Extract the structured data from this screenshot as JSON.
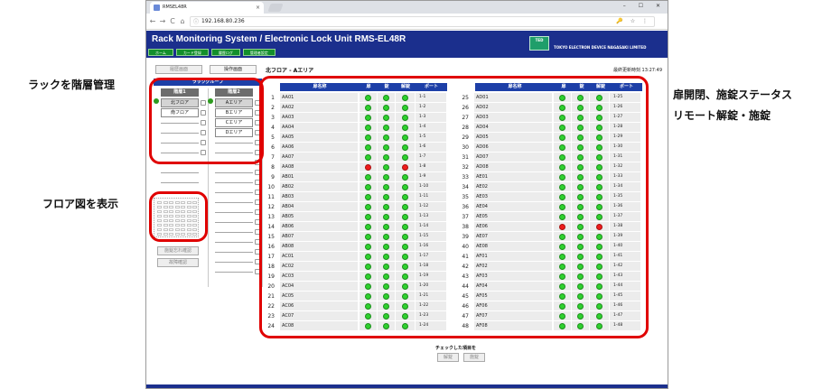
{
  "browser": {
    "tab_title": "RMSEL48R",
    "tab_close": "×",
    "url": "192.168.80.236",
    "url_info_icon": "ⓘ",
    "toolbar_icons": "🔑 ☆ ⋮",
    "window_controls": "– ☐ ✕",
    "nav": {
      "back": "←",
      "forward": "→",
      "reload": "C",
      "home": "⌂"
    }
  },
  "app": {
    "title": "Rack Monitoring System / Electronic Lock Unit RMS-EL48R",
    "menu": [
      "ホーム",
      "カード登録",
      "履歴ログ",
      "管理者設定"
    ],
    "logo_text": "TED",
    "company": "TOKYO ELECTRON DEVICE NAGASAKI LIMITED",
    "colors": {
      "header": "#1b2f8d",
      "menu": "#138f2c",
      "table_header": "#1d3fa7",
      "led_green": "#2fd02f",
      "led_red": "#ee1c1c"
    }
  },
  "buttons": {
    "history_view": "履歴画面",
    "operation_view": "操作画面",
    "floor_check": "施錠忘れ確認",
    "fault_check": "故障確認",
    "unlock": "解錠",
    "lock": "施錠"
  },
  "area_title": "北フロア - Aエリア",
  "updated": "最終更新時刻 13:27:49",
  "group": {
    "heading": "ラックグループ",
    "level1_label": "階層1",
    "level2_label": "階層2",
    "level1_items": [
      "北フロア",
      "南フロア"
    ],
    "level2_items": [
      "Aエリア",
      "Bエリア",
      "Cエリア",
      "Dエリア"
    ]
  },
  "table": {
    "headers": {
      "name": "扉名称",
      "door": "扉",
      "lock": "錠",
      "unlock": "解錠",
      "port": "ポート"
    },
    "rows": [
      {
        "num": "1",
        "name": "AA01",
        "port": "1-1",
        "door": "green",
        "lock": "green",
        "unlock": "green"
      },
      {
        "num": "2",
        "name": "AA02",
        "port": "1-2",
        "door": "green",
        "lock": "green",
        "unlock": "green"
      },
      {
        "num": "3",
        "name": "AA03",
        "port": "1-3",
        "door": "green",
        "lock": "green",
        "unlock": "green"
      },
      {
        "num": "4",
        "name": "AA04",
        "port": "1-4",
        "door": "green",
        "lock": "green",
        "unlock": "green"
      },
      {
        "num": "5",
        "name": "AA05",
        "port": "1-5",
        "door": "green",
        "lock": "green",
        "unlock": "green"
      },
      {
        "num": "6",
        "name": "AA06",
        "port": "1-6",
        "door": "green",
        "lock": "green",
        "unlock": "green"
      },
      {
        "num": "7",
        "name": "AA07",
        "port": "1-7",
        "door": "green",
        "lock": "green",
        "unlock": "green"
      },
      {
        "num": "8",
        "name": "AA08",
        "port": "1-8",
        "door": "red",
        "lock": "green",
        "unlock": "red"
      },
      {
        "num": "9",
        "name": "AB01",
        "port": "1-9",
        "door": "green",
        "lock": "green",
        "unlock": "green"
      },
      {
        "num": "10",
        "name": "AB02",
        "port": "1-10",
        "door": "green",
        "lock": "green",
        "unlock": "green"
      },
      {
        "num": "11",
        "name": "AB03",
        "port": "1-11",
        "door": "green",
        "lock": "green",
        "unlock": "green"
      },
      {
        "num": "12",
        "name": "AB04",
        "port": "1-12",
        "door": "green",
        "lock": "green",
        "unlock": "green"
      },
      {
        "num": "13",
        "name": "AB05",
        "port": "1-13",
        "door": "green",
        "lock": "green",
        "unlock": "green"
      },
      {
        "num": "14",
        "name": "AB06",
        "port": "1-14",
        "door": "green",
        "lock": "green",
        "unlock": "green"
      },
      {
        "num": "15",
        "name": "AB07",
        "port": "1-15",
        "door": "green",
        "lock": "green",
        "unlock": "green"
      },
      {
        "num": "16",
        "name": "AB08",
        "port": "1-16",
        "door": "green",
        "lock": "green",
        "unlock": "green"
      },
      {
        "num": "17",
        "name": "AC01",
        "port": "1-17",
        "door": "green",
        "lock": "green",
        "unlock": "green"
      },
      {
        "num": "18",
        "name": "AC02",
        "port": "1-18",
        "door": "green",
        "lock": "green",
        "unlock": "green"
      },
      {
        "num": "19",
        "name": "AC03",
        "port": "1-19",
        "door": "green",
        "lock": "green",
        "unlock": "green"
      },
      {
        "num": "20",
        "name": "AC04",
        "port": "1-20",
        "door": "green",
        "lock": "green",
        "unlock": "green"
      },
      {
        "num": "21",
        "name": "AC05",
        "port": "1-21",
        "door": "green",
        "lock": "green",
        "unlock": "green"
      },
      {
        "num": "22",
        "name": "AC06",
        "port": "1-22",
        "door": "green",
        "lock": "green",
        "unlock": "green"
      },
      {
        "num": "23",
        "name": "AC07",
        "port": "1-23",
        "door": "green",
        "lock": "green",
        "unlock": "green"
      },
      {
        "num": "24",
        "name": "AC08",
        "port": "1-24",
        "door": "green",
        "lock": "green",
        "unlock": "green"
      },
      {
        "num": "25",
        "name": "AD01",
        "port": "1-25",
        "door": "green",
        "lock": "green",
        "unlock": "green"
      },
      {
        "num": "26",
        "name": "AD02",
        "port": "1-26",
        "door": "green",
        "lock": "green",
        "unlock": "green"
      },
      {
        "num": "27",
        "name": "AD03",
        "port": "1-27",
        "door": "green",
        "lock": "green",
        "unlock": "green"
      },
      {
        "num": "28",
        "name": "AD04",
        "port": "1-28",
        "door": "green",
        "lock": "green",
        "unlock": "green"
      },
      {
        "num": "29",
        "name": "AD05",
        "port": "1-29",
        "door": "green",
        "lock": "green",
        "unlock": "green"
      },
      {
        "num": "30",
        "name": "AD06",
        "port": "1-30",
        "door": "green",
        "lock": "green",
        "unlock": "green"
      },
      {
        "num": "31",
        "name": "AD07",
        "port": "1-31",
        "door": "green",
        "lock": "green",
        "unlock": "green"
      },
      {
        "num": "32",
        "name": "AD08",
        "port": "1-32",
        "door": "green",
        "lock": "green",
        "unlock": "green"
      },
      {
        "num": "33",
        "name": "AE01",
        "port": "1-33",
        "door": "green",
        "lock": "green",
        "unlock": "green"
      },
      {
        "num": "34",
        "name": "AE02",
        "port": "1-34",
        "door": "green",
        "lock": "green",
        "unlock": "green"
      },
      {
        "num": "35",
        "name": "AE03",
        "port": "1-35",
        "door": "green",
        "lock": "green",
        "unlock": "green"
      },
      {
        "num": "36",
        "name": "AE04",
        "port": "1-36",
        "door": "green",
        "lock": "green",
        "unlock": "green"
      },
      {
        "num": "37",
        "name": "AE05",
        "port": "1-37",
        "door": "green",
        "lock": "green",
        "unlock": "green"
      },
      {
        "num": "38",
        "name": "AE06",
        "port": "1-38",
        "door": "red",
        "lock": "green",
        "unlock": "red"
      },
      {
        "num": "39",
        "name": "AE07",
        "port": "1-39",
        "door": "green",
        "lock": "green",
        "unlock": "green"
      },
      {
        "num": "40",
        "name": "AE08",
        "port": "1-40",
        "door": "green",
        "lock": "green",
        "unlock": "green"
      },
      {
        "num": "41",
        "name": "AF01",
        "port": "1-41",
        "door": "green",
        "lock": "green",
        "unlock": "green"
      },
      {
        "num": "42",
        "name": "AF02",
        "port": "1-42",
        "door": "green",
        "lock": "green",
        "unlock": "green"
      },
      {
        "num": "43",
        "name": "AF03",
        "port": "1-43",
        "door": "green",
        "lock": "green",
        "unlock": "green"
      },
      {
        "num": "44",
        "name": "AF04",
        "port": "1-44",
        "door": "green",
        "lock": "green",
        "unlock": "green"
      },
      {
        "num": "45",
        "name": "AF05",
        "port": "1-45",
        "door": "green",
        "lock": "green",
        "unlock": "green"
      },
      {
        "num": "46",
        "name": "AF06",
        "port": "1-46",
        "door": "green",
        "lock": "green",
        "unlock": "green"
      },
      {
        "num": "47",
        "name": "AF07",
        "port": "1-47",
        "door": "green",
        "lock": "green",
        "unlock": "green"
      },
      {
        "num": "48",
        "name": "AF08",
        "port": "1-48",
        "door": "green",
        "lock": "green",
        "unlock": "green"
      }
    ]
  },
  "bottom": {
    "label": "チェックした項目を"
  },
  "annotations": {
    "rack_hierarchy": "ラックを階層管理",
    "floor_map": "フロア図を表示",
    "status_line1": "扉開閉、施錠ステータス",
    "status_line2": "リモート解錠・施錠"
  }
}
